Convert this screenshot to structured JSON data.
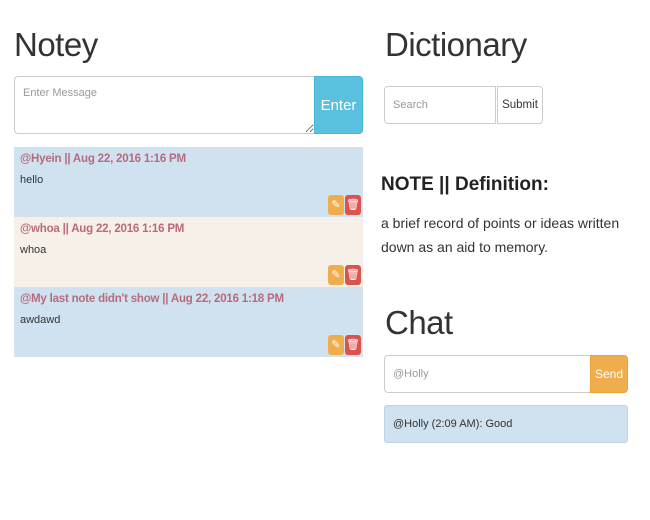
{
  "notey": {
    "title": "Notey",
    "message_placeholder": "Enter Message",
    "enter_label": "Enter",
    "notes": [
      {
        "header": "@Hyein || Aug 22, 2016 1:16 PM",
        "body": "hello",
        "style": "blue"
      },
      {
        "header": "@whoa || Aug 22, 2016 1:16 PM",
        "body": "whoa",
        "style": "cream"
      },
      {
        "header": "@My last note didn't show || Aug 22, 2016 1:18 PM",
        "body": "awdawd",
        "style": "blue"
      }
    ],
    "edit_icon": "edit-icon",
    "delete_icon": "trash-icon",
    "edit_glyph": "✎",
    "delete_glyph": "🗑"
  },
  "dictionary": {
    "title": "Dictionary",
    "search_placeholder": "Search",
    "submit_label": "Submit",
    "definition_heading": "NOTE || Definition:",
    "definition_text": "a brief record of points or ideas written down as an aid to memory."
  },
  "chat": {
    "title": "Chat",
    "input_value": "@Holly",
    "send_label": "Send",
    "messages": [
      "@Holly (2:09 AM): Good"
    ]
  },
  "colors": {
    "info": "#5bc0de",
    "warning": "#f0ad4e",
    "danger": "#d9534f",
    "note_blue": "#d0e2ef",
    "note_cream": "#f6f0e8",
    "note_header": "#b86a7c"
  }
}
